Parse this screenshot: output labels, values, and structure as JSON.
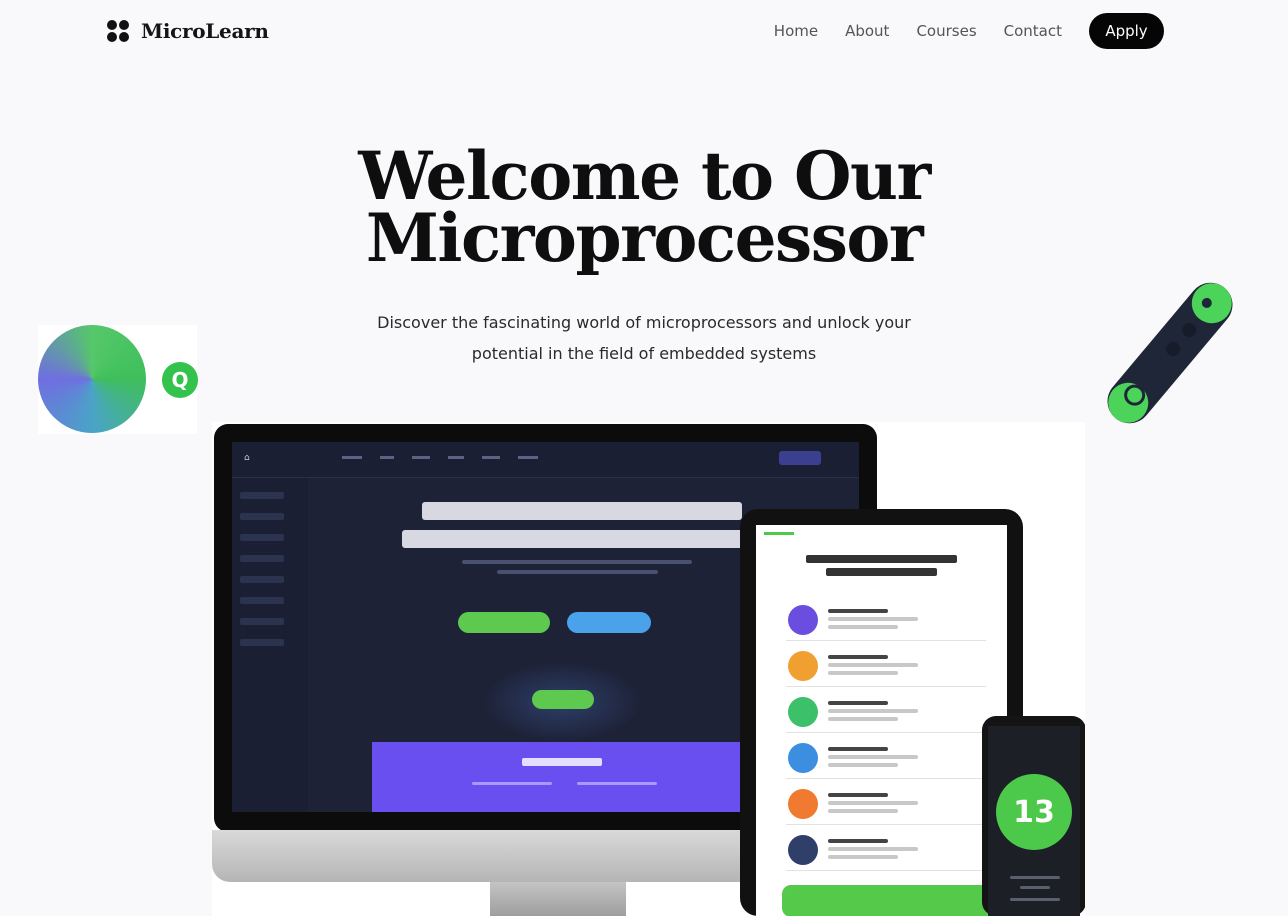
{
  "brand": {
    "name": "MicroLearn",
    "logo_icon": "four-dots-icon"
  },
  "nav": {
    "links": [
      "Home",
      "About",
      "Courses",
      "Contact"
    ],
    "cta": "Apply"
  },
  "hero": {
    "title_line1": "Welcome to Our",
    "title_line2": "Microprocessor",
    "subtitle_line1": "Discover the fascinating world of microprocessors and unlock your",
    "subtitle_line2": "potential in the field of embedded systems"
  },
  "colors": {
    "accent_green": "#4cc94a",
    "accent_purple": "#6a4ff0",
    "accent_blue": "#4aa2ea",
    "nav_button": "#050505"
  },
  "mockup": {
    "tablet_dot_colors": [
      "#6b4de0",
      "#f0a030",
      "#3cc06a",
      "#3c8fe0",
      "#f07a30",
      "#2f3f6a"
    ]
  }
}
